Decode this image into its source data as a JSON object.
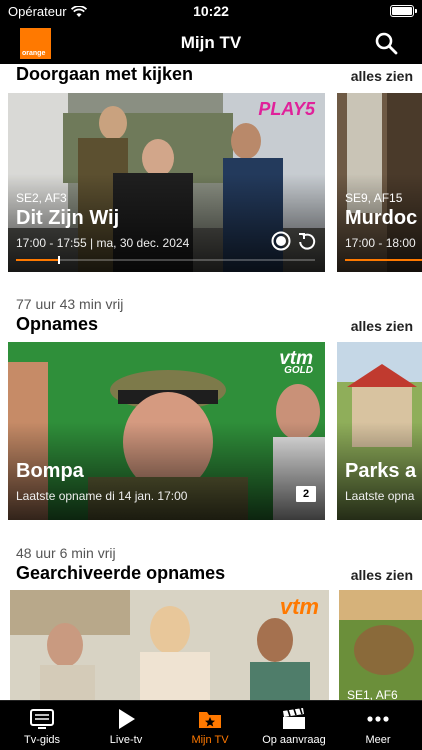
{
  "status_bar": {
    "carrier": "Opérateur",
    "time": "10:22"
  },
  "header": {
    "logo_text": "orange",
    "title": "Mijn TV"
  },
  "continue_watching": {
    "title": "Doorgaan met kijken",
    "see_all": "alles zien",
    "cards": [
      {
        "episode": "SE2, AF3",
        "title": "Dit Zijn Wij",
        "meta": "17:00 - 17:55 | ma, 30 dec. 2024",
        "channel": "PLAY5",
        "progress": 0.14
      },
      {
        "episode": "SE9, AF15",
        "title": "Murdoc",
        "meta": "17:00 - 18:00",
        "progress": 0.0
      }
    ]
  },
  "recordings": {
    "free_space": "77 uur 43 min vrij",
    "title": "Opnames",
    "see_all": "alles zien",
    "cards": [
      {
        "title": "Bompa",
        "meta": "Laatste opname di 14 jan. 17:00",
        "channel_main": "vtm",
        "channel_sub": "GOLD",
        "count": "2"
      },
      {
        "title": "Parks a",
        "meta": "Laatste opna"
      }
    ]
  },
  "archived": {
    "free_space": "48 uur 6 min vrij",
    "title": "Gearchiveerde opnames",
    "see_all": "alles zien",
    "cards": [
      {
        "channel": "vtm"
      },
      {
        "episode": "SE1, AF6"
      }
    ]
  },
  "tab_bar": {
    "items": [
      {
        "label": "Tv-gids",
        "icon": "tv-guide-icon"
      },
      {
        "label": "Live-tv",
        "icon": "play-icon"
      },
      {
        "label": "Mijn TV",
        "icon": "my-tv-icon",
        "active": true
      },
      {
        "label": "Op aanvraag",
        "icon": "clapperboard-icon"
      },
      {
        "label": "Meer",
        "icon": "more-icon"
      }
    ]
  },
  "colors": {
    "accent": "#ff7900",
    "header_bg": "#000000"
  }
}
